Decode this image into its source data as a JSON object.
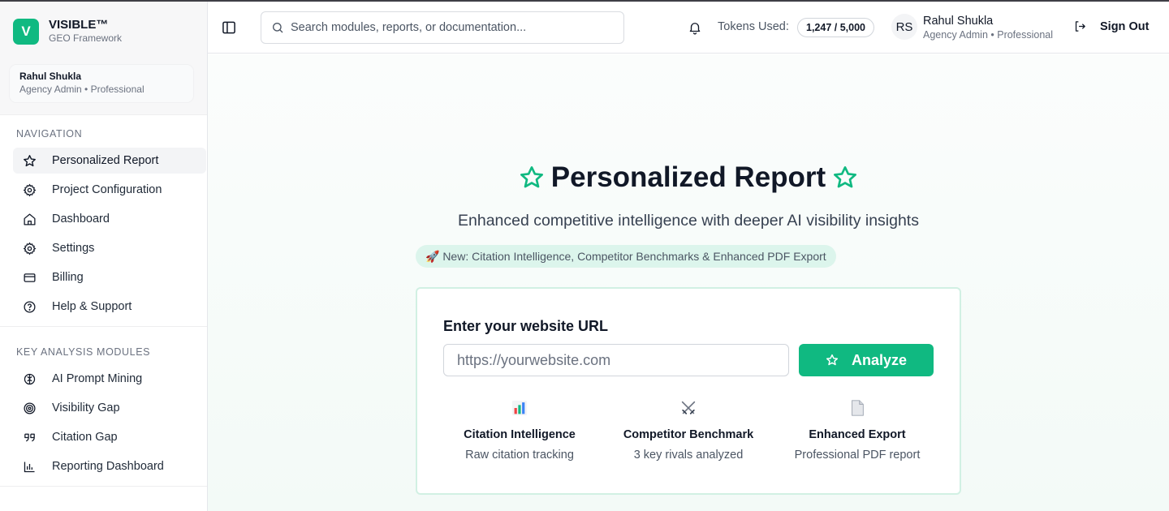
{
  "brand": {
    "logo_letter": "V",
    "name": "VISIBLE™",
    "subtitle": "GEO Framework"
  },
  "user": {
    "name": "Rahul Shukla",
    "role": "Agency Admin • Professional",
    "initials": "RS"
  },
  "sidebar": {
    "navigation_title": "NAVIGATION",
    "navigation": [
      {
        "label": "Personalized Report",
        "icon": "star-icon",
        "active": true
      },
      {
        "label": "Project Configuration",
        "icon": "gear-icon"
      },
      {
        "label": "Dashboard",
        "icon": "home-icon"
      },
      {
        "label": "Settings",
        "icon": "gear-icon"
      },
      {
        "label": "Billing",
        "icon": "credit-card-icon"
      },
      {
        "label": "Help & Support",
        "icon": "help-circle-icon"
      }
    ],
    "modules_title": "KEY ANALYSIS MODULES",
    "modules": [
      {
        "label": "AI Prompt Mining",
        "icon": "brain-icon"
      },
      {
        "label": "Visibility Gap",
        "icon": "target-icon"
      },
      {
        "label": "Citation Gap",
        "icon": "quote-icon"
      },
      {
        "label": "Reporting Dashboard",
        "icon": "bar-chart-icon"
      }
    ]
  },
  "header": {
    "search_placeholder": "Search modules, reports, or documentation...",
    "tokens_label": "Tokens Used:",
    "tokens_value": "1,247 / 5,000",
    "sign_out": "Sign Out"
  },
  "main": {
    "title": "Personalized Report",
    "subtitle": "Enhanced competitive intelligence with deeper AI visibility insights",
    "pill": "🚀 New: Citation Intelligence, Competitor Benchmarks & Enhanced PDF Export",
    "form_label": "Enter your website URL",
    "url_placeholder": "https://yourwebsite.com",
    "analyze_button": "Analyze",
    "features": [
      {
        "title": "Citation Intelligence",
        "desc": "Raw citation tracking",
        "icon": "bar-chart-emoji-icon"
      },
      {
        "title": "Competitor Benchmark",
        "desc": "3 key rivals analyzed",
        "icon": "crossed-swords-icon"
      },
      {
        "title": "Enhanced Export",
        "desc": "Professional PDF report",
        "icon": "document-icon"
      }
    ]
  },
  "colors": {
    "accent": "#10b981",
    "accent_light": "#dcf5ec",
    "text": "#111827",
    "muted": "#6b7280"
  }
}
